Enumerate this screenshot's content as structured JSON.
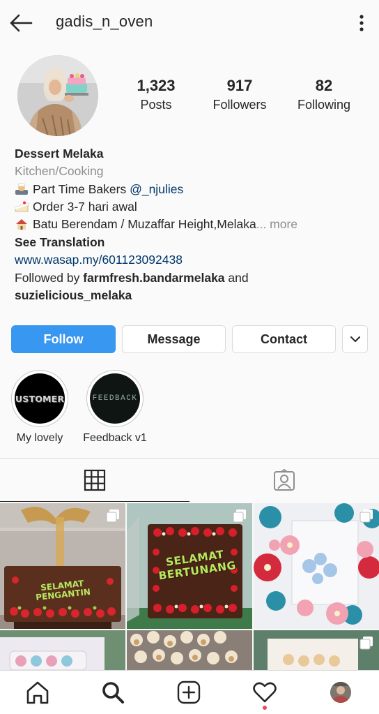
{
  "header": {
    "username": "gadis_n_oven",
    "back_icon": "back-arrow-icon",
    "menu_icon": "more-vertical-icon"
  },
  "stats": {
    "posts_count": "1,323",
    "posts_label": "Posts",
    "followers_count": "917",
    "followers_label": "Followers",
    "following_count": "82",
    "following_label": "Following"
  },
  "bio": {
    "name": "Dessert Melaka",
    "category": "Kitchen/Cooking",
    "line1_text": "Part Time Bakers ",
    "line1_mention": "@_njulies",
    "line2_text": "Order 3-7 hari awal",
    "line3_text": "Batu Berendam / Muzaffar Height,Melaka",
    "line3_ellipsis": "...",
    "line3_more": " more",
    "see_translation": "See Translation",
    "website": "www.wasap.my/601123092438",
    "followed_by_prefix": "Followed by ",
    "followed_by_user1": "farmfresh.bandarmelaka",
    "followed_by_and": " and",
    "followed_by_user2": "suzielicious_melaka"
  },
  "actions": {
    "follow": "Follow",
    "message": "Message",
    "contact": "Contact"
  },
  "highlights": [
    {
      "label": "My lovely",
      "cover_text": "CUSTOMERS"
    },
    {
      "label": "Feedback v1",
      "cover_text": "FEEDBACK"
    }
  ],
  "posts": [
    {
      "cake_text": "SELAMAT PENGANTIN",
      "multi": true
    },
    {
      "cake_text": "SELAMAT BERTUNANG",
      "multi": true
    },
    {
      "cake_text": "",
      "multi": true
    }
  ],
  "colors": {
    "accent": "#3897f0",
    "link": "#00376b",
    "muted": "#8e8e8e",
    "notification_dot": "#ed4956"
  }
}
